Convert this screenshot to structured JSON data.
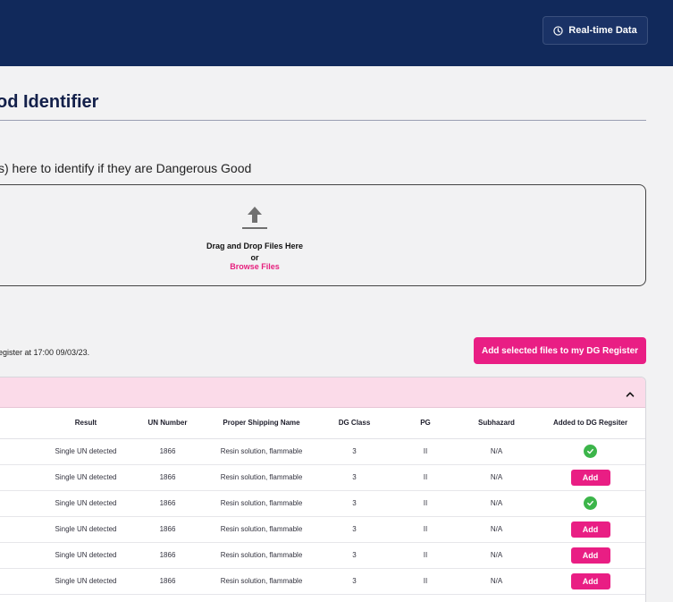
{
  "header": {
    "realtime_label": "Real-time Data"
  },
  "page": {
    "title": "od Identifier",
    "intro": "s) here to identify if they are Dangerous Good"
  },
  "dropzone": {
    "heading": "Drag and Drop Files Here",
    "or": "or",
    "browse": "Browse Files"
  },
  "register": {
    "note": "egister at 17:00 09/03/23.",
    "add_selected_label": "Add selected files to my DG Register"
  },
  "table": {
    "columns": [
      "Result",
      "UN Number",
      "Proper Shipping Name",
      "DG Class",
      "PG",
      "Subhazard",
      "Added to DG Regsiter"
    ],
    "rows": [
      {
        "result": "Single UN detected",
        "un": "1866",
        "psn": "Resin solution, flammable",
        "dg_class": "3",
        "pg": "II",
        "subhazard": "N/A",
        "added": true
      },
      {
        "result": "Single UN detected",
        "un": "1866",
        "psn": "Resin solution, flammable",
        "dg_class": "3",
        "pg": "II",
        "subhazard": "N/A",
        "added": false
      },
      {
        "result": "Single UN detected",
        "un": "1866",
        "psn": "Resin solution, flammable",
        "dg_class": "3",
        "pg": "II",
        "subhazard": "N/A",
        "added": true
      },
      {
        "result": "Single UN detected",
        "un": "1866",
        "psn": "Resin solution, flammable",
        "dg_class": "3",
        "pg": "II",
        "subhazard": "N/A",
        "added": false
      },
      {
        "result": "Single UN detected",
        "un": "1866",
        "psn": "Resin solution, flammable",
        "dg_class": "3",
        "pg": "II",
        "subhazard": "N/A",
        "added": false
      },
      {
        "result": "Single UN detected",
        "un": "1866",
        "psn": "Resin solution, flammable",
        "dg_class": "3",
        "pg": "II",
        "subhazard": "N/A",
        "added": false
      }
    ],
    "add_label": "Add"
  },
  "icons": {
    "realtime": "clock-icon",
    "upload": "upload-icon",
    "collapse": "chevron-up-icon",
    "added": "check-circle-icon"
  },
  "colors": {
    "header_bg": "#11295b",
    "accent": "#e91e84",
    "success": "#3cb54a",
    "table_band": "#fbdbe9"
  }
}
